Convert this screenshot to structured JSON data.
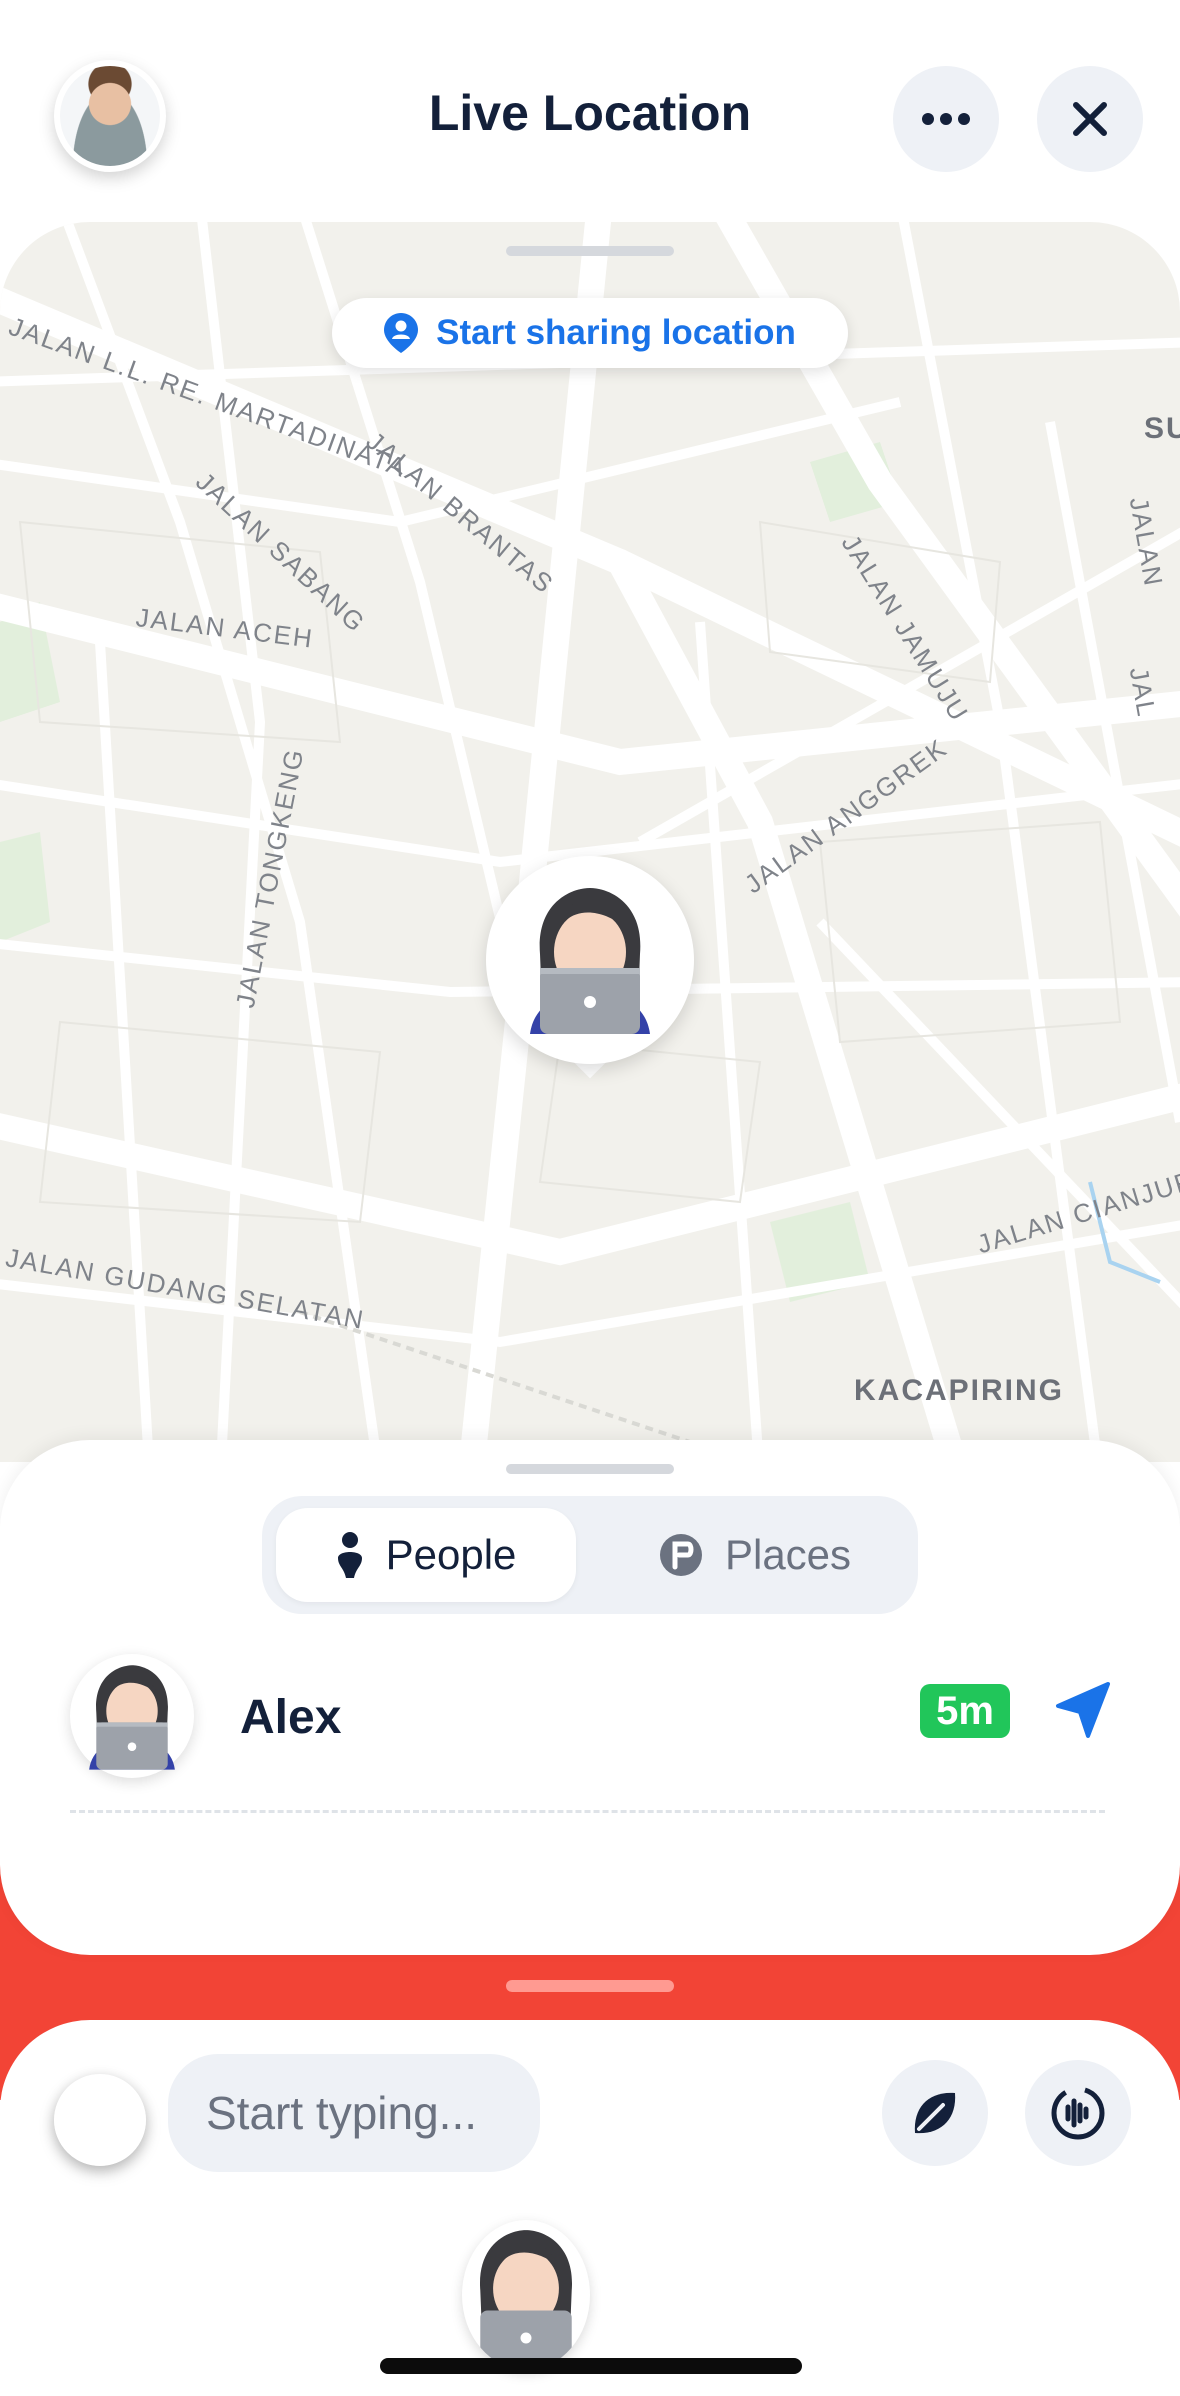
{
  "header": {
    "title": "Live Location",
    "more_icon": "ellipsis-icon",
    "close_icon": "close-icon"
  },
  "map": {
    "share_button_label": "Start sharing location",
    "share_icon": "person-pin-icon",
    "streets": [
      "JALAN L.L. RE. MARTADINATA",
      "JALAN SABANG",
      "JALAN BRANTAS",
      "JALAN ACEH",
      "JALAN JAMUJU",
      "JALAN ANGGREK",
      "JALAN TONGKENG",
      "JALAN CIANJUR",
      "JALAN GUDANG SELATAN",
      "KACAPIRING",
      "SU",
      "JALAN",
      "JAL"
    ]
  },
  "sheet": {
    "tabs": {
      "people": "People",
      "places": "Places"
    },
    "people": [
      {
        "name": "Alex",
        "last_seen": "5m",
        "avatar_icon": "woman-laptop-emoji"
      }
    ]
  },
  "composer": {
    "placeholder": "Start typing...",
    "leaf_icon": "leaf-icon",
    "voice_icon": "voice-wave-icon"
  },
  "colors": {
    "accent_blue": "#1a73e8",
    "badge_green": "#21c65a",
    "sheet_red": "#f24436",
    "title_navy": "#13203a"
  }
}
